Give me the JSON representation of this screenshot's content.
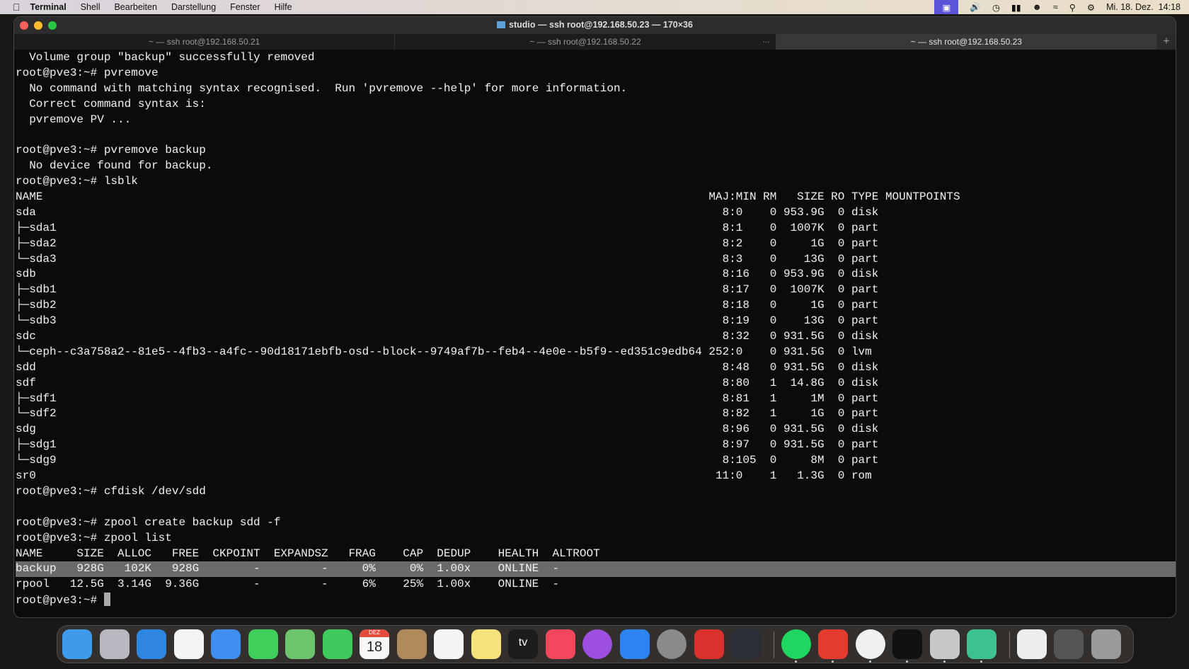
{
  "menubar": {
    "app": "Terminal",
    "items": [
      "Shell",
      "Bearbeiten",
      "Darstellung",
      "Fenster",
      "Hilfe"
    ],
    "clock": "Mi. 18. Dez.  14:18",
    "status_icons": [
      "screen-mirroring-icon",
      "volume-icon",
      "time-machine-icon",
      "battery-icon",
      "user-icon",
      "wifi-icon",
      "spotlight-icon",
      "control-center-icon"
    ]
  },
  "window": {
    "title": "studio — ssh root@192.168.50.23 — 170×36",
    "tabs": [
      {
        "label": "~ — ssh root@192.168.50.21",
        "active": false
      },
      {
        "label": "~ — ssh root@192.168.50.22",
        "active": false,
        "more": "..."
      },
      {
        "label": "~ — ssh root@192.168.50.23",
        "active": true
      }
    ],
    "new_tab": "+"
  },
  "terminal": {
    "lines_before": [
      "  Volume group \"backup\" successfully removed",
      "root@pve3:~# pvremove",
      "  No command with matching syntax recognised.  Run 'pvremove --help' for more information.",
      "  Correct command syntax is:",
      "  pvremove PV ...",
      "",
      "root@pve3:~# pvremove backup",
      "  No device found for backup.",
      "root@pve3:~# lsblk"
    ],
    "lsblk": {
      "header": [
        "NAME",
        "MAJ:MIN",
        "RM",
        "SIZE",
        "RO",
        "TYPE",
        "MOUNTPOINTS"
      ],
      "rows": [
        [
          "sda",
          "8:0",
          "0",
          "953.9G",
          "0",
          "disk"
        ],
        [
          "├─sda1",
          "8:1",
          "0",
          "1007K",
          "0",
          "part"
        ],
        [
          "├─sda2",
          "8:2",
          "0",
          "1G",
          "0",
          "part"
        ],
        [
          "└─sda3",
          "8:3",
          "0",
          "13G",
          "0",
          "part"
        ],
        [
          "sdb",
          "8:16",
          "0",
          "953.9G",
          "0",
          "disk"
        ],
        [
          "├─sdb1",
          "8:17",
          "0",
          "1007K",
          "0",
          "part"
        ],
        [
          "├─sdb2",
          "8:18",
          "0",
          "1G",
          "0",
          "part"
        ],
        [
          "└─sdb3",
          "8:19",
          "0",
          "13G",
          "0",
          "part"
        ],
        [
          "sdc",
          "8:32",
          "0",
          "931.5G",
          "0",
          "disk"
        ],
        [
          "└─ceph--c3a758a2--81e5--4fb3--a4fc--90d18171ebfb-osd--block--9749af7b--feb4--4e0e--b5f9--ed351c9edb64",
          "252:0",
          "0",
          "931.5G",
          "0",
          "lvm"
        ],
        [
          "sdd",
          "8:48",
          "0",
          "931.5G",
          "0",
          "disk"
        ],
        [
          "sdf",
          "8:80",
          "1",
          "14.8G",
          "0",
          "disk"
        ],
        [
          "├─sdf1",
          "8:81",
          "1",
          "1M",
          "0",
          "part"
        ],
        [
          "└─sdf2",
          "8:82",
          "1",
          "1G",
          "0",
          "part"
        ],
        [
          "sdg",
          "8:96",
          "0",
          "931.5G",
          "0",
          "disk"
        ],
        [
          "├─sdg1",
          "8:97",
          "0",
          "931.5G",
          "0",
          "part"
        ],
        [
          "└─sdg9",
          "8:105",
          "0",
          "8M",
          "0",
          "part"
        ],
        [
          "sr0",
          "11:0",
          "1",
          "1.3G",
          "0",
          "rom"
        ]
      ]
    },
    "lines_mid": [
      "root@pve3:~# cfdisk /dev/sdd",
      "",
      "root@pve3:~# zpool create backup sdd -f",
      "root@pve3:~# zpool list"
    ],
    "zpool": {
      "header": [
        "NAME",
        "SIZE",
        "ALLOC",
        "FREE",
        "CKPOINT",
        "EXPANDSZ",
        "FRAG",
        "CAP",
        "DEDUP",
        "HEALTH",
        "ALTROOT"
      ],
      "rows": [
        [
          "backup",
          "928G",
          "102K",
          "928G",
          "-",
          "-",
          "0%",
          "0%",
          "1.00x",
          "ONLINE",
          "-"
        ],
        [
          "rpool",
          "12.5G",
          "3.14G",
          "9.36G",
          "-",
          "-",
          "6%",
          "25%",
          "1.00x",
          "ONLINE",
          "-"
        ]
      ],
      "highlighted_row": 0
    },
    "prompt": "root@pve3:~# "
  },
  "dock": {
    "apps": [
      {
        "name": "finder",
        "color": "#3d9be9"
      },
      {
        "name": "launchpad",
        "color": "#b8b8c0"
      },
      {
        "name": "safari",
        "color": "#2f86e0"
      },
      {
        "name": "photos",
        "color": "#f4f4f4"
      },
      {
        "name": "mail",
        "color": "#3f8ef0"
      },
      {
        "name": "messages",
        "color": "#3fcf5a"
      },
      {
        "name": "maps",
        "color": "#6cc46c"
      },
      {
        "name": "facetime",
        "color": "#3ec95a"
      },
      {
        "name": "calendar",
        "color": "#f7f7f7",
        "text": "18",
        "sub": "DEZ"
      },
      {
        "name": "contacts",
        "color": "#b08a5a"
      },
      {
        "name": "reminders",
        "color": "#f5f5f5"
      },
      {
        "name": "notes",
        "color": "#f6e27a"
      },
      {
        "name": "apple-tv",
        "color": "#1c1c1c",
        "text": "tv"
      },
      {
        "name": "music",
        "color": "#f2475d"
      },
      {
        "name": "podcasts",
        "color": "#9c4fe0"
      },
      {
        "name": "app-store",
        "color": "#2d84f0"
      },
      {
        "name": "system-settings",
        "color": "#8a8a8a"
      },
      {
        "name": "disk-utility",
        "color": "#d8322a"
      },
      {
        "name": "quicktime",
        "color": "#2a2f3a"
      },
      {
        "name": "spotify",
        "color": "#1ed760",
        "group": 2,
        "running": true
      },
      {
        "name": "tomato-app",
        "color": "#e33b2d",
        "group": 2,
        "running": true
      },
      {
        "name": "chrome",
        "color": "#f0f0f0",
        "group": 2,
        "running": true
      },
      {
        "name": "terminal",
        "color": "#111111",
        "group": 2,
        "running": true
      },
      {
        "name": "calculator",
        "color": "#c8c8c8",
        "group": 2,
        "running": true
      },
      {
        "name": "sync-app",
        "color": "#3ec28f",
        "group": 2,
        "running": true
      },
      {
        "name": "archive-file",
        "color": "#eeeeee",
        "group": 3
      },
      {
        "name": "downloads-stack",
        "color": "#555555",
        "group": 3
      },
      {
        "name": "trash",
        "color": "#9a9a9a",
        "group": 3
      }
    ]
  }
}
